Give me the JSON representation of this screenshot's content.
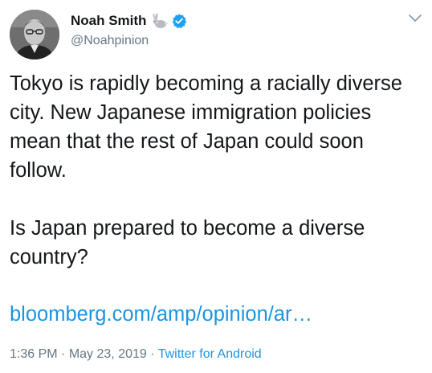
{
  "tweet": {
    "author": {
      "display_name": "Noah Smith",
      "handle": "@Noahpinion",
      "verified": true,
      "avatar_icon": "avatar-portrait",
      "emoji_icon": "rabbit-icon"
    },
    "paragraphs": [
      "Tokyo is rapidly becoming a racially diverse city. New Japanese immigration policies mean that the rest of Japan could soon follow.",
      "Is Japan prepared to become a diverse country?"
    ],
    "link_text": "bloomberg.com/amp/opinion/ar…",
    "time": "1:36 PM",
    "separator": "·",
    "date": "May 23, 2019",
    "source": "Twitter for Android"
  },
  "colors": {
    "text": "#14171a",
    "secondary": "#657786",
    "accent": "#1b95e0"
  }
}
